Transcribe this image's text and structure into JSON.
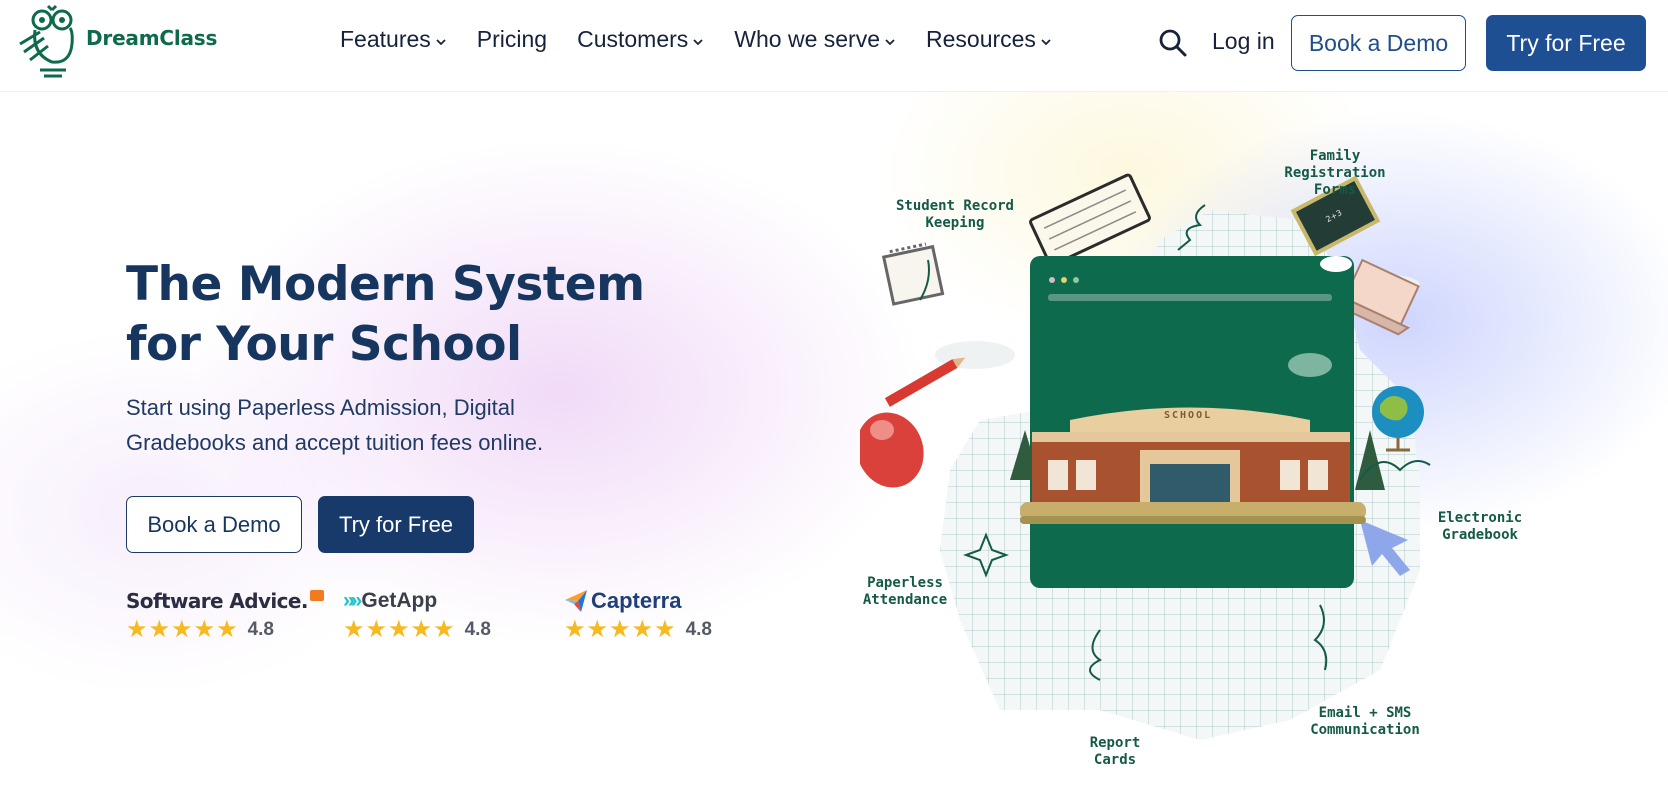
{
  "brand": {
    "name": "DreamClass"
  },
  "nav": {
    "items": [
      {
        "label": "Features",
        "dropdown": true
      },
      {
        "label": "Pricing",
        "dropdown": false
      },
      {
        "label": "Customers",
        "dropdown": true
      },
      {
        "label": "Who we serve",
        "dropdown": true
      },
      {
        "label": "Resources",
        "dropdown": true
      }
    ],
    "login": "Log in",
    "book_demo": "Book a Demo",
    "try_free": "Try for Free"
  },
  "hero": {
    "title_line1": "The Modern System",
    "title_line2": "for Your School",
    "subtitle_line1": "Start using Paperless Admission, Digital",
    "subtitle_line2": "Gradebooks and accept tuition fees online.",
    "book_demo": "Book a Demo",
    "try_free": "Try for Free"
  },
  "ratings": [
    {
      "brand": "Software Advice.",
      "score": "4.8",
      "stars": "★★★★★"
    },
    {
      "brand": "GetApp",
      "score": "4.8",
      "stars": "★★★★★"
    },
    {
      "brand": "Capterra",
      "score": "4.8",
      "stars": "★★★★★"
    }
  ],
  "illustration": {
    "building_sign": "SCHOOL",
    "labels": {
      "student_record": [
        "Student Record",
        "Keeping"
      ],
      "family_registration": [
        "Family",
        "Registration",
        "Forms"
      ],
      "electronic_gradebook": [
        "Electronic",
        "Gradebook"
      ],
      "paperless_attendance": [
        "Paperless",
        "Attendance"
      ],
      "email_sms": [
        "Email + SMS",
        "Communication"
      ],
      "report_cards": [
        "Report",
        "Cards"
      ]
    }
  },
  "colors": {
    "brand_green": "#0e6a4d",
    "navy": "#17365f",
    "primary_blue": "#1f4f93",
    "star_gold": "#f6b91e"
  }
}
